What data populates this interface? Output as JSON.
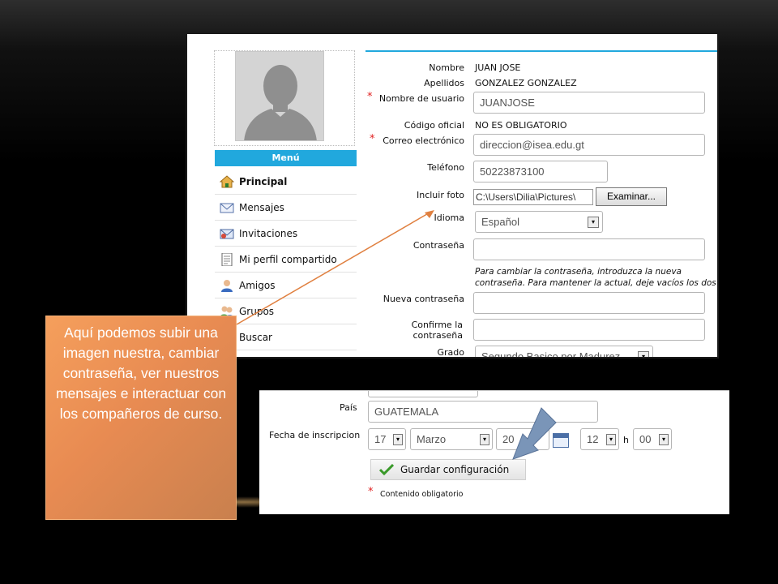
{
  "colors": {
    "menu_header": "#21a8dd",
    "callout": "#e88b52",
    "required": "#e02020",
    "down_arrow": "#7a95b8",
    "pointer_line": "#e08040"
  },
  "profile": {
    "menu": {
      "header": "Menú",
      "items": [
        {
          "label": "Principal",
          "icon": "home-icon"
        },
        {
          "label": "Mensajes",
          "icon": "envelope-icon"
        },
        {
          "label": "Invitaciones",
          "icon": "invitation-icon"
        },
        {
          "label": "Mi perfil compartido",
          "icon": "document-icon"
        },
        {
          "label": "Amigos",
          "icon": "person-icon"
        },
        {
          "label": "Grupos",
          "icon": "group-icon"
        },
        {
          "label": "Buscar",
          "icon": "search-icon"
        }
      ]
    },
    "fields": {
      "nombre_label": "Nombre",
      "nombre_value": "JUAN JOSE",
      "apellidos_label": "Apellidos",
      "apellidos_value": "GONZALEZ GONZALEZ",
      "usuario_label": "Nombre de usuario",
      "usuario_value": "JUANJOSE",
      "codigo_label": "Código oficial",
      "codigo_value": "NO ES OBLIGATORIO",
      "correo_label": "Correo electrónico",
      "correo_value": "direccion@isea.edu.gt",
      "telefono_label": "Teléfono",
      "telefono_value": "50223873100",
      "foto_label": "Incluir foto",
      "foto_value": "C:\\Users\\Dilia\\Pictures\\",
      "browse_label": "Examinar...",
      "idioma_label": "Idioma",
      "idioma_value": "Español",
      "contrasena_label": "Contraseña",
      "hint": "Para cambiar la contraseña, introduzca la nueva contraseña. Para mantener la actual, deje vacíos los dos campos.",
      "nueva_label": "Nueva contraseña",
      "confirme_label": "Confirme la contraseña",
      "grado_label": "Grado",
      "grado_value": "Segundo Basico por Madurez"
    },
    "required_mark": "*"
  },
  "bottom": {
    "pais_label": "País",
    "pais_value": "GUATEMALA",
    "fecha_label": "Fecha de inscripcion",
    "day": "17",
    "month": "Marzo",
    "year": "20",
    "hour": "12",
    "h_sep": "h",
    "minute": "00",
    "save_label": "Guardar configuración",
    "required_note": "Contenido obligatorio",
    "required_mark": "*"
  },
  "callout": {
    "text": "Aquí podemos subir una imagen nuestra, cambiar contraseña, ver nuestros mensajes e interactuar con los compañeros de curso."
  }
}
